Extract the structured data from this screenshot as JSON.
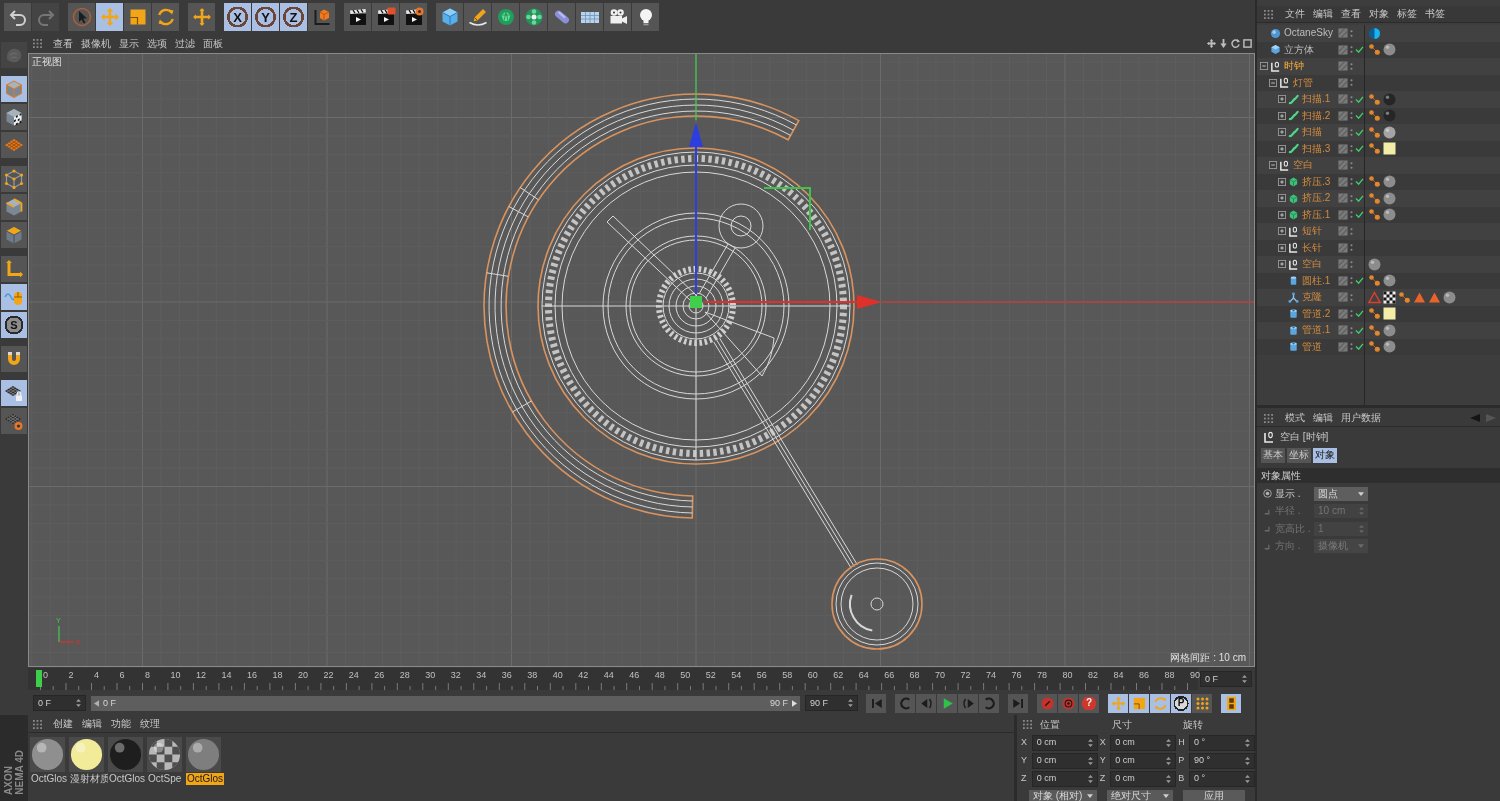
{
  "toolbar": {
    "buttons": [
      {
        "selected": false,
        "disabled": false
      },
      {
        "selected": false,
        "disabled": true
      },
      {
        "selected": false,
        "disabled": false
      },
      {
        "selected": true,
        "disabled": false
      },
      {
        "selected": false,
        "disabled": false
      },
      {
        "selected": false,
        "disabled": false
      },
      {
        "selected": false,
        "disabled": false
      },
      {
        "label": "X",
        "selected": true,
        "disabled": false
      },
      {
        "label": "Y",
        "selected": true,
        "disabled": false
      },
      {
        "label": "Z",
        "selected": true,
        "disabled": false
      },
      {
        "selected": false,
        "disabled": false
      },
      {
        "selected": false,
        "disabled": false
      },
      {
        "selected": false,
        "disabled": false
      },
      {
        "selected": false,
        "disabled": false
      },
      {
        "selected": false,
        "disabled": false
      },
      {
        "selected": false,
        "disabled": false
      },
      {
        "selected": false,
        "disabled": false
      },
      {
        "selected": false,
        "disabled": false
      },
      {
        "selected": false,
        "disabled": false
      },
      {
        "selected": false,
        "disabled": false
      },
      {
        "selected": false,
        "disabled": false
      },
      {
        "selected": false,
        "disabled": false
      }
    ]
  },
  "tool_palette": {
    "buttons": [
      {
        "selected": false,
        "disabled": true
      },
      {
        "selected": true,
        "disabled": false
      },
      {
        "selected": false,
        "disabled": false
      },
      {
        "selected": false,
        "disabled": false
      },
      {
        "selected": false,
        "disabled": false
      },
      {
        "selected": false,
        "disabled": false
      },
      {
        "selected": false,
        "disabled": false
      },
      {
        "selected": false,
        "disabled": false
      },
      {
        "selected": true,
        "disabled": false
      },
      {
        "label": "S",
        "selected": true,
        "disabled": false
      },
      {
        "selected": false,
        "disabled": false
      },
      {
        "selected": true,
        "disabled": false
      },
      {
        "selected": false,
        "disabled": false
      }
    ]
  },
  "viewport": {
    "menu": [
      "查看",
      "摄像机",
      "显示",
      "选项",
      "过滤",
      "面板"
    ],
    "view_label": "正视图",
    "grid_spacing": "网格间距 : 10 cm",
    "axis_gizmo": {
      "y": "Y",
      "x": "X"
    }
  },
  "timeline": {
    "ticks": [
      "0",
      "2",
      "4",
      "6",
      "8",
      "10",
      "12",
      "14",
      "16",
      "18",
      "20",
      "22",
      "24",
      "26",
      "28",
      "30",
      "32",
      "34",
      "36",
      "38",
      "40",
      "42",
      "44",
      "46",
      "48",
      "50",
      "52",
      "54",
      "56",
      "58",
      "60",
      "62",
      "64",
      "66",
      "68",
      "70",
      "72",
      "74",
      "76",
      "78",
      "80",
      "82",
      "84",
      "86",
      "88",
      "90"
    ],
    "playhead": {
      "level": 0
    },
    "current_frame": "0 F"
  },
  "transport": {
    "start": "0 F",
    "range": {
      "start": "0 F",
      "end": "90 F",
      "level": 1
    },
    "end": "90 F",
    "buttons": [
      {
        "selected": false
      },
      {
        "selected": false
      },
      {
        "selected": false
      },
      {
        "selected": false
      },
      {
        "selected": false
      },
      {
        "selected": false
      },
      {
        "selected": false
      },
      {
        "selected": false
      },
      {
        "selected": false
      },
      {
        "label": "?",
        "selected": false
      },
      {
        "selected": true
      },
      {
        "selected": true
      },
      {
        "selected": true
      },
      {
        "label": "P",
        "selected": true
      },
      {
        "selected": false
      },
      {
        "selected": true
      }
    ]
  },
  "materials": {
    "menu": [
      "创建",
      "编辑",
      "功能",
      "纹理"
    ],
    "items": [
      {
        "name": "OctGlos",
        "kind": "sphere",
        "color": "#8f8f8f",
        "selected": false
      },
      {
        "name": "漫射材质",
        "kind": "sphere",
        "color": "#f2ec9a",
        "selected": false
      },
      {
        "name": "OctGlos",
        "kind": "sphere",
        "color": "#1e1e1e",
        "selected": false
      },
      {
        "name": "OctSpe",
        "kind": "checker",
        "color": "#b8b8b8",
        "selected": false
      },
      {
        "name": "OctGlos",
        "kind": "sphere",
        "color": "#7e7e7e",
        "selected": true
      }
    ]
  },
  "coordinates": {
    "headers": [
      "位置",
      "尺寸",
      "旋转"
    ],
    "rows": [
      [
        {
          "axis": "X",
          "value": "0 cm"
        },
        {
          "axis": "X",
          "value": "0 cm"
        },
        {
          "axis": "H",
          "value": "0 °"
        }
      ],
      [
        {
          "axis": "Y",
          "value": "0 cm"
        },
        {
          "axis": "Y",
          "value": "0 cm"
        },
        {
          "axis": "P",
          "value": "90 °"
        }
      ],
      [
        {
          "axis": "Z",
          "value": "0 cm"
        },
        {
          "axis": "Z",
          "value": "0 cm"
        },
        {
          "axis": "B",
          "value": "0 °"
        }
      ]
    ],
    "mode": "对象 (相对)",
    "size_mode": "绝对尺寸",
    "apply": "应用"
  },
  "logo": [
    "AXON",
    "NEMA 4D"
  ],
  "objects": {
    "menu": [
      "文件",
      "编辑",
      "查看",
      "对象",
      "标签",
      "书签"
    ],
    "items": [
      {
        "name": "OctaneSky",
        "kind": "sky",
        "selected": false,
        "enabled": false,
        "tags": [
          {
            "kind": "sky"
          }
        ]
      },
      {
        "name": "立方体",
        "kind": "cube",
        "selected": false,
        "enabled": true,
        "tags": [
          {
            "kind": "phong"
          },
          {
            "kind": "sphere",
            "color": "#8c8c8c"
          }
        ]
      },
      {
        "name": "时钟",
        "kind": "null",
        "selected": true,
        "expanded": true,
        "enabled": false,
        "children": [
          {
            "name": "灯管",
            "kind": "null",
            "selected": false,
            "expanded": true,
            "enabled": false,
            "children": [
              {
                "name": "扫描.1",
                "kind": "sweep",
                "selected": false,
                "expanded": false,
                "enabled": true,
                "tags": [
                  {
                    "kind": "phong"
                  },
                  {
                    "kind": "sphere",
                    "color": "#262626"
                  }
                ]
              },
              {
                "name": "扫描.2",
                "kind": "sweep",
                "selected": false,
                "expanded": false,
                "enabled": true,
                "tags": [
                  {
                    "kind": "phong"
                  },
                  {
                    "kind": "sphere",
                    "color": "#262626"
                  }
                ]
              },
              {
                "name": "扫描",
                "kind": "sweep",
                "selected": false,
                "expanded": false,
                "enabled": true,
                "tags": [
                  {
                    "kind": "phong"
                  },
                  {
                    "kind": "sphere",
                    "color": "#a4a4a4"
                  }
                ]
              },
              {
                "name": "扫描.3",
                "kind": "sweep",
                "selected": false,
                "expanded": false,
                "enabled": true,
                "tags": [
                  {
                    "kind": "phong"
                  },
                  {
                    "kind": "swatch",
                    "color": "#f3eda8"
                  }
                ]
              }
            ]
          },
          {
            "name": "空白",
            "kind": "null",
            "selected": false,
            "expanded": true,
            "enabled": false,
            "children": [
              {
                "name": "挤压.3",
                "kind": "extrude",
                "selected": false,
                "expanded": false,
                "enabled": true,
                "tags": [
                  {
                    "kind": "phong"
                  },
                  {
                    "kind": "sphere",
                    "color": "#8c8c8c"
                  }
                ]
              },
              {
                "name": "挤压.2",
                "kind": "extrude",
                "selected": false,
                "expanded": false,
                "enabled": true,
                "tags": [
                  {
                    "kind": "phong"
                  },
                  {
                    "kind": "sphere",
                    "color": "#8c8c8c"
                  }
                ]
              },
              {
                "name": "挤压.1",
                "kind": "extrude",
                "selected": false,
                "expanded": false,
                "enabled": true,
                "tags": [
                  {
                    "kind": "phong"
                  },
                  {
                    "kind": "sphere",
                    "color": "#8c8c8c"
                  }
                ]
              },
              {
                "name": "短针",
                "kind": "null",
                "selected": false,
                "expanded": false,
                "enabled": false
              },
              {
                "name": "长针",
                "kind": "null",
                "selected": false,
                "expanded": false,
                "enabled": false
              },
              {
                "name": "空白",
                "kind": "null",
                "selected": false,
                "expanded": false,
                "enabled": false,
                "tags": [
                  {
                    "kind": "sphere",
                    "color": "#8c8c8c"
                  }
                ]
              },
              {
                "name": "圆柱.1",
                "kind": "cylinder",
                "selected": false,
                "enabled": true,
                "tags": [
                  {
                    "kind": "phong"
                  },
                  {
                    "kind": "sphere",
                    "color": "#8c8c8c"
                  }
                ]
              },
              {
                "name": "克隆",
                "kind": "cloner",
                "selected": false,
                "enabled": false,
                "tags": [
                  {
                    "kind": "alert"
                  },
                  {
                    "kind": "checker"
                  },
                  {
                    "kind": "phong"
                  },
                  {
                    "kind": "cone"
                  },
                  {
                    "kind": "cone"
                  },
                  {
                    "kind": "sphere",
                    "color": "#8c8c8c"
                  }
                ]
              },
              {
                "name": "管道.2",
                "kind": "tube",
                "selected": false,
                "enabled": true,
                "tags": [
                  {
                    "kind": "phong"
                  },
                  {
                    "kind": "swatch",
                    "color": "#f3eda8"
                  }
                ]
              },
              {
                "name": "管道.1",
                "kind": "tube",
                "selected": false,
                "enabled": true,
                "tags": [
                  {
                    "kind": "phong"
                  },
                  {
                    "kind": "sphere",
                    "color": "#8c8c8c"
                  }
                ]
              },
              {
                "name": "管道",
                "kind": "tube",
                "selected": false,
                "enabled": true,
                "tags": [
                  {
                    "kind": "phong"
                  },
                  {
                    "kind": "sphere",
                    "color": "#8c8c8c"
                  }
                ]
              }
            ]
          }
        ]
      }
    ]
  },
  "attributes": {
    "menu": [
      "模式",
      "编辑",
      "用户数据"
    ],
    "title": "空白 [时钟]",
    "tabs": [
      {
        "label": "基本",
        "selected": false
      },
      {
        "label": "坐标",
        "selected": false
      },
      {
        "label": "对象",
        "selected": true
      }
    ],
    "section": "对象属性",
    "fields": [
      {
        "label": "显示 .",
        "kind": "dropdown",
        "value": "圆点",
        "disabled": false
      },
      {
        "label": "半径 .",
        "kind": "number",
        "value": "10 cm",
        "disabled": true
      },
      {
        "label": "宽高比 .",
        "kind": "number",
        "value": "1",
        "disabled": true
      },
      {
        "label": "方向 .",
        "kind": "dropdown",
        "value": "摄像机",
        "disabled": true
      }
    ]
  }
}
